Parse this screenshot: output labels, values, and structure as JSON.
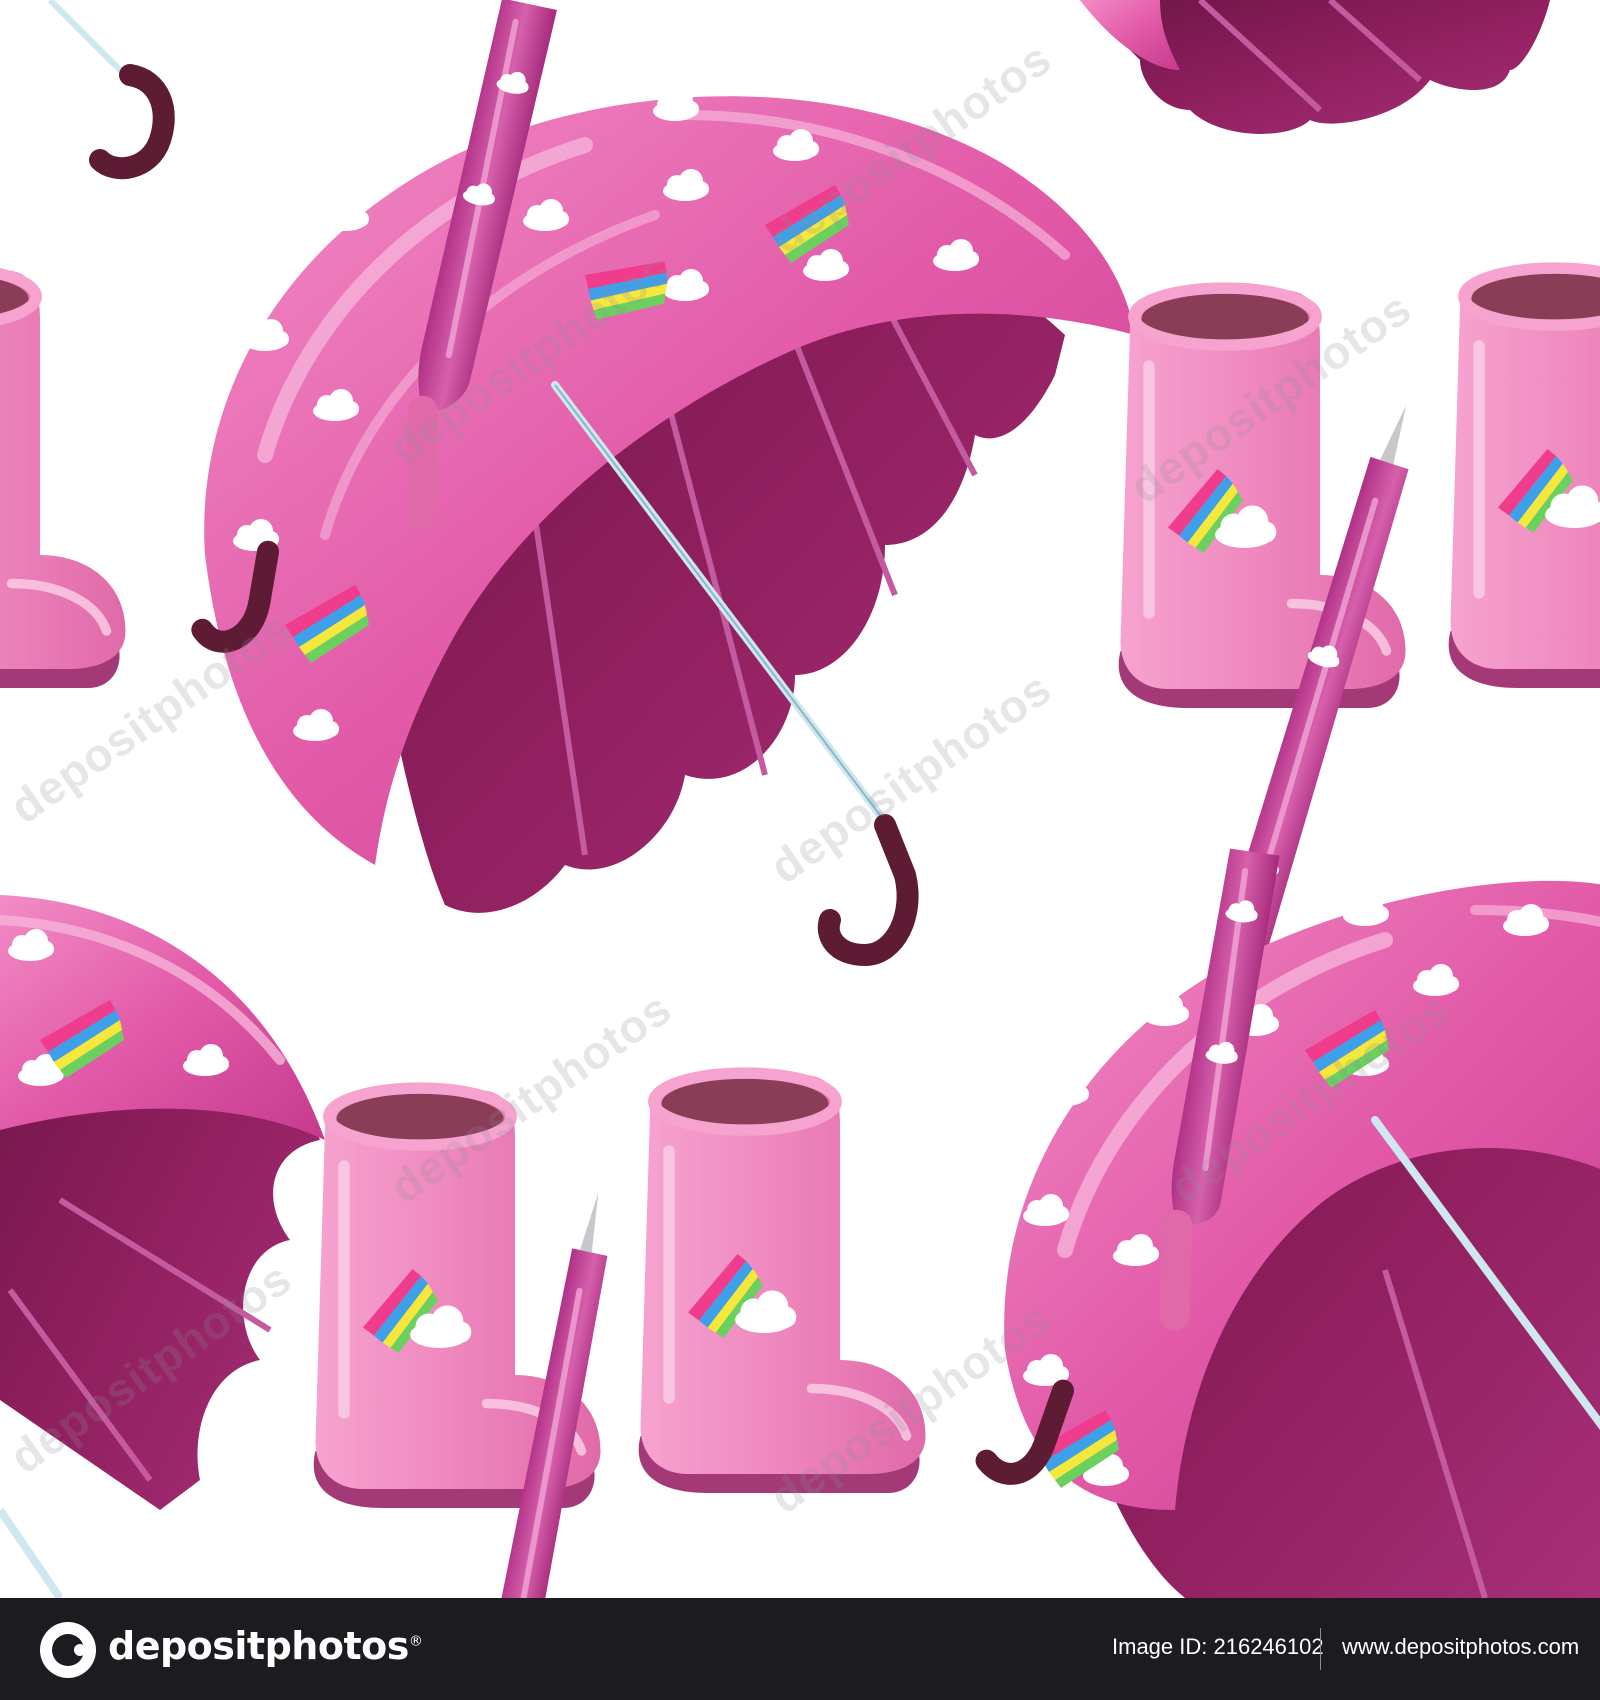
{
  "artwork": {
    "watermark": "depositphotos",
    "colors": {
      "canopy_top": "#e25aa8",
      "canopy_inner": "#8f1f5e",
      "canopy_light": "#f3a0cf",
      "boot_pink": "#ee86bd",
      "boot_dark": "#a33a77",
      "handle": "#5e1c34",
      "shaft": "#cfe7ee",
      "cloud": "#ffffff",
      "rainbow_pink": "#f03c8c",
      "rainbow_blue": "#3ea0e8",
      "rainbow_yellow": "#f5e83c",
      "rainbow_green": "#6bd15e"
    }
  },
  "footer": {
    "brand": "depositphotos",
    "brand_mark": "®",
    "image_id": "Image ID: 216246102",
    "site": "www.depositphotos.com"
  }
}
